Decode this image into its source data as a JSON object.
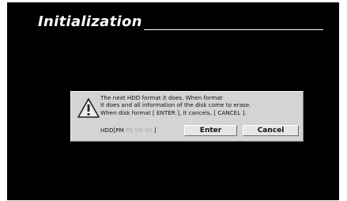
{
  "screen": {
    "title": "Initialization"
  },
  "dialog": {
    "icon": "warning-icon",
    "message_lines": [
      "The next HDD format it does. When format",
      "it does and all information of the disk come to erase.",
      "When disk format [ ENTER ], it cancels, [ CANCEL ]."
    ],
    "hdd_label": "HDD[PM",
    "hdd_dim": " PS SM SS ",
    "hdd_close": "]",
    "enter_label": "Enter",
    "cancel_label": "Cancel"
  },
  "colors": {
    "background": "#000000",
    "dialog": "#d4d4d4",
    "button": "#e6e6e6",
    "text": "#111111",
    "dim_text": "#a8a8a8"
  }
}
